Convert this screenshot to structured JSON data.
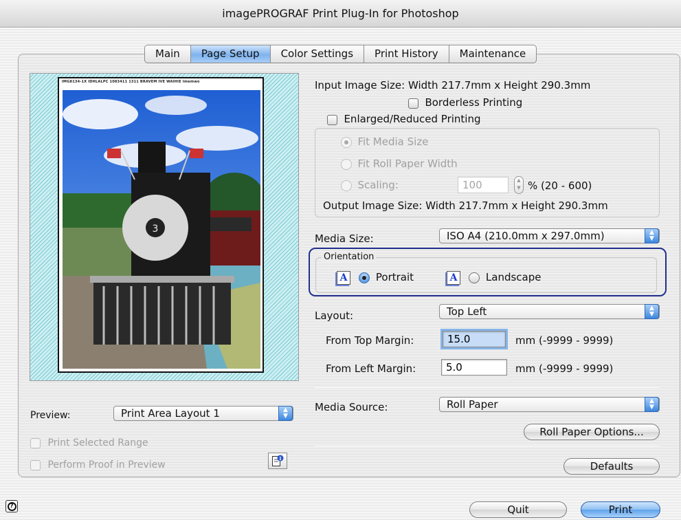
{
  "window": {
    "title": "imagePROGRAF Print Plug-In for Photoshop"
  },
  "tabs": [
    "Main",
    "Page Setup",
    "Color Settings",
    "Print History",
    "Maintenance"
  ],
  "active_tab": "Page Setup",
  "preview_area": {
    "paper_header_text": "IMG8134-1X  IDHLALPC  1083411 1311  BRAVEM IVE  WAIHIE  Imemwo"
  },
  "page_setup": {
    "input_size": "Input Image Size: Width 217.7mm x Height 290.3mm",
    "borderless_label": "Borderless Printing",
    "enlarged_label": "Enlarged/Reduced Printing",
    "fit_media_label": "Fit Media Size",
    "fit_roll_label": "Fit Roll Paper Width",
    "scaling_label": "Scaling:",
    "scaling_value": "100",
    "scaling_range": "% (20 - 600)",
    "output_size": "Output Image Size: Width 217.7mm x Height 290.3mm",
    "media_size_label": "Media Size:",
    "media_size_value": "ISO A4 (210.0mm x 297.0mm)",
    "orientation_title": "Orientation",
    "portrait_label": "Portrait",
    "landscape_label": "Landscape",
    "orientation_icon_letter": "A",
    "layout_label": "Layout:",
    "layout_value": "Top Left",
    "top_margin_label": "From Top Margin:",
    "top_margin_value": "15.0",
    "top_margin_range": "mm (-9999 - 9999)",
    "left_margin_label": "From Left Margin:",
    "left_margin_value": "5.0",
    "left_margin_range": "mm (-9999 - 9999)",
    "media_source_label": "Media Source:",
    "media_source_value": "Roll Paper",
    "roll_paper_options": "Roll Paper Options...",
    "defaults": "Defaults"
  },
  "preview_controls": {
    "preview_label": "Preview:",
    "preview_value": "Print Area Layout 1",
    "print_selected_range": "Print Selected Range",
    "perform_proof": "Perform Proof in Preview"
  },
  "footer": {
    "help_glyph": "?",
    "quit": "Quit",
    "print": "Print"
  },
  "colors": {
    "accent_blue": "#5fa2ea",
    "orientation_border": "#1f2f8c",
    "preview_cyan": "#7cc9d2"
  }
}
